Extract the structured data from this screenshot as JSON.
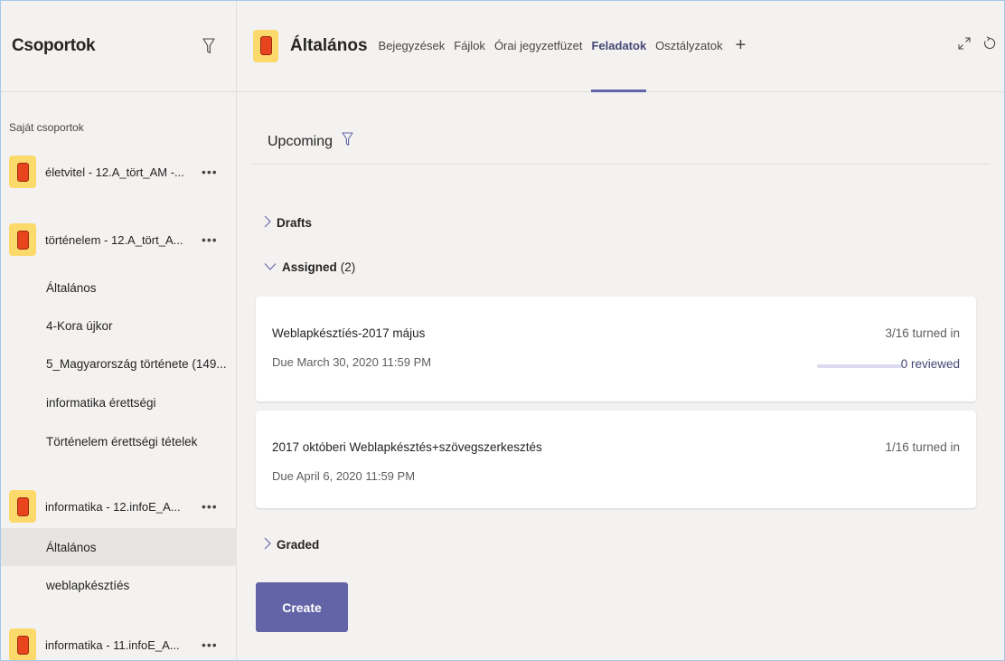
{
  "sidebar": {
    "title": "Csoportok",
    "section_label": "Saját csoportok",
    "teams": [
      {
        "name": "életvitel - 12.A_tört_AM -...",
        "more": "•••"
      },
      {
        "name": "történelem - 12.A_tört_A...",
        "more": "•••",
        "channels": [
          "Általános",
          "4-Kora újkor",
          "5_Magyarország története (149...",
          "informatika érettségi",
          "Történelem érettségi tételek"
        ]
      },
      {
        "name": "informatika - 12.infoE_A...",
        "more": "•••",
        "channels": [
          "Általános",
          "weblapkésztíés"
        ]
      },
      {
        "name": "informatika - 11.infoE_A...",
        "more": "•••"
      }
    ]
  },
  "header": {
    "channel_title": "Általános",
    "tabs": [
      "Bejegyzések",
      "Fájlok",
      "Órai jegyzetfüzet",
      "Feladatok",
      "Osztályzatok"
    ],
    "active_tab": "Feladatok",
    "add_tab": "+"
  },
  "main": {
    "upcoming_label": "Upcoming",
    "drafts_label": "Drafts",
    "assigned_label": "Assigned",
    "assigned_count": "(2)",
    "graded_label": "Graded",
    "create_label": "Create",
    "assignments": [
      {
        "title": "Weblapkésztíés-2017 május",
        "due": "Due March 30, 2020 11:59 PM",
        "turned_in": "3/16 turned in",
        "reviewed": "0 reviewed",
        "reviewed_fraction": 0.0
      },
      {
        "title": "2017 októberi Weblapkésztés+szövegszerkesztés",
        "due": "Due April 6, 2020 11:59 PM",
        "turned_in": "1/16 turned in"
      }
    ]
  },
  "colors": {
    "accent": "#6264a7",
    "avatar_bg": "#fcd96b",
    "avatar_fg": "#e8451f",
    "background": "#f3f2f1"
  }
}
